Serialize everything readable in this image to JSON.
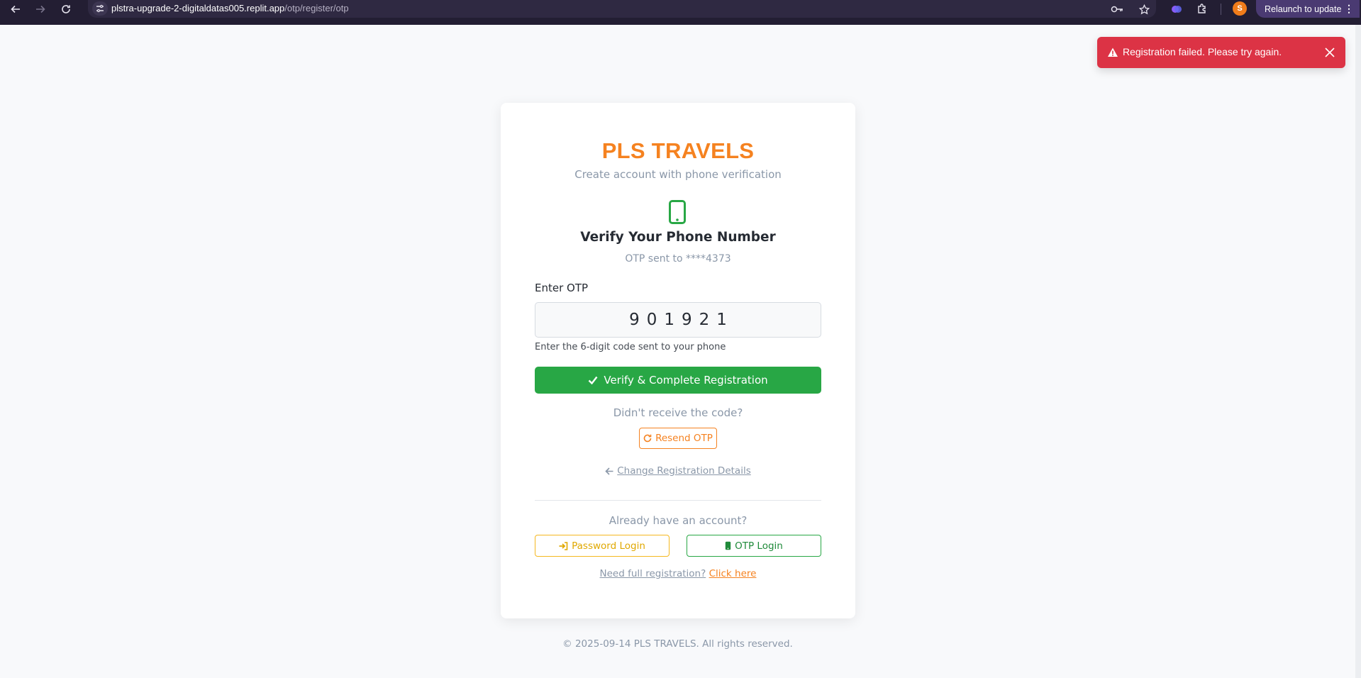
{
  "browser": {
    "url_host": "plstra-upgrade-2-digitaldatas005.replit.app",
    "url_path": "/otp/register/otp",
    "profile_initial": "S",
    "relaunch_label": "Relaunch to update"
  },
  "toast": {
    "message": "Registration failed. Please try again.",
    "color": "#dc3345"
  },
  "card": {
    "brand": "PLS TRAVELS",
    "subtitle": "Create account with phone verification",
    "title": "Verify Your Phone Number",
    "otp_sent": "OTP sent to ****4373",
    "otp_label": "Enter OTP",
    "otp_value": "901921",
    "otp_hint": "Enter the 6-digit code sent to your phone",
    "verify_label": "Verify & Complete Registration",
    "didnt_receive": "Didn't receive the code?",
    "resend_label": "Resend OTP",
    "change_details": "Change Registration Details",
    "already_account": "Already have an account?",
    "password_login": "Password Login",
    "otp_login": "OTP Login",
    "full_reg_question": "Need full registration?",
    "full_reg_link": "Click here"
  },
  "footer": "© 2025-09-14 PLS TRAVELS. All rights reserved.",
  "colors": {
    "brand": "#f58220",
    "success": "#28a745",
    "warning": "#f5b820",
    "danger": "#dc3345"
  }
}
